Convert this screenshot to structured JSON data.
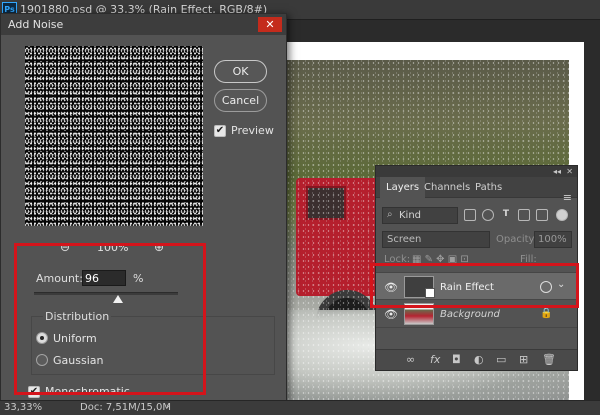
{
  "app": {
    "icon_text": "Ps",
    "document_title": "1901880.psd @ 33,3% (Rain Effect, RGB/8#)"
  },
  "dialog": {
    "title": "Add Noise",
    "close": "✕",
    "zoom_out": "⊖",
    "zoom_level": "100%",
    "zoom_in": "⊕",
    "ok": "OK",
    "cancel": "Cancel",
    "preview_label": "Preview",
    "preview_checked": true,
    "amount_label": "Amount:",
    "amount_value": "96",
    "amount_unit": "%",
    "amount_slider_fraction": 0.79,
    "distribution_label": "Distribution",
    "distribution_options": [
      "Uniform",
      "Gaussian"
    ],
    "distribution_selected": "Uniform",
    "monochromatic_label": "Monochromatic",
    "monochromatic_checked": true,
    "checkmark": "✔"
  },
  "layers_panel": {
    "collapse": "◂◂",
    "close": "✕",
    "tabs": [
      "Layers",
      "Channels",
      "Paths"
    ],
    "active_tab": "Layers",
    "menu": "≡",
    "filter_glyph": "⌕",
    "filter_label": "Kind",
    "blend_mode": "Screen",
    "opacity_label": "Opacity:",
    "opacity_value": "100%",
    "lock_label": "Lock:",
    "fill_label": "Fill:",
    "layers": [
      {
        "name": "Rain Effect",
        "visible": true,
        "selected": true
      },
      {
        "name": "Background",
        "visible": true,
        "locked": true
      }
    ],
    "eye_icon": "👁",
    "chevron": "⌄",
    "lock_icon": "🔒",
    "bottom_icons": [
      "∞",
      "fx",
      "◘",
      "◐",
      "▭",
      "⊞",
      "🗑"
    ]
  },
  "status_bar": {
    "zoom": "33,33%",
    "doc": "Doc: 7,51M/15,0M",
    "arrow": "›"
  },
  "colors": {
    "highlight": "#d4141b",
    "accent_blue": "#31a8ff"
  }
}
